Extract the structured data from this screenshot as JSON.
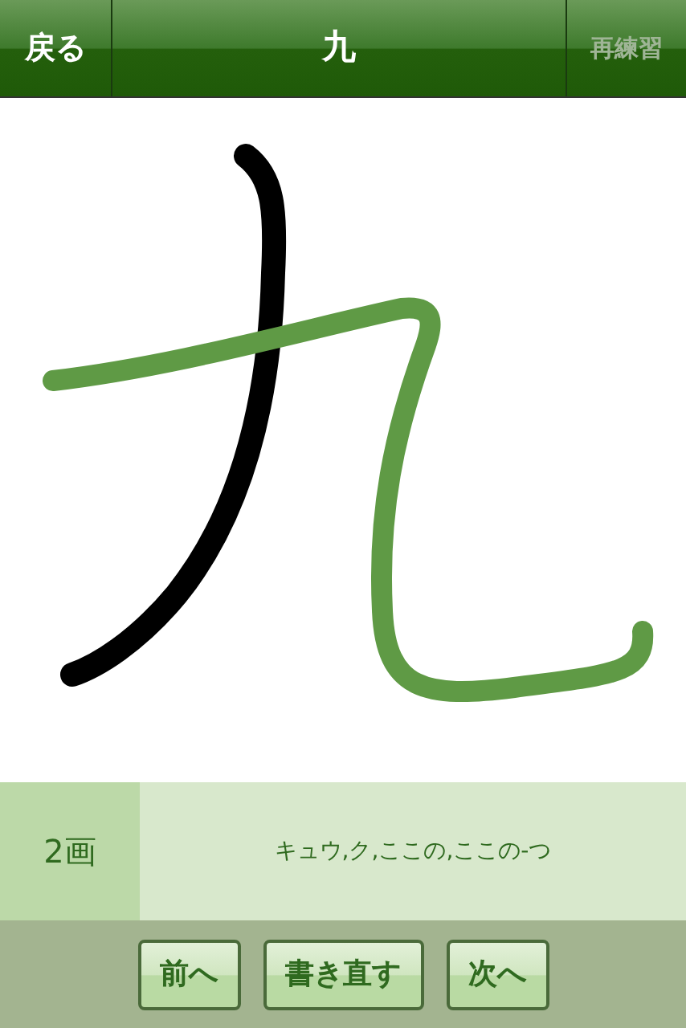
{
  "nav_bar": {
    "back_button": "戻る",
    "title": "九",
    "retry_button": {
      "label": "再練習",
      "disabled": true
    }
  },
  "info": {
    "stroke_count": "2画",
    "readings": "キュウ,ク,ここの,ここの-つ"
  },
  "toolbar": {
    "buttons": [
      "前へ",
      "書き直す",
      "次へ"
    ]
  }
}
